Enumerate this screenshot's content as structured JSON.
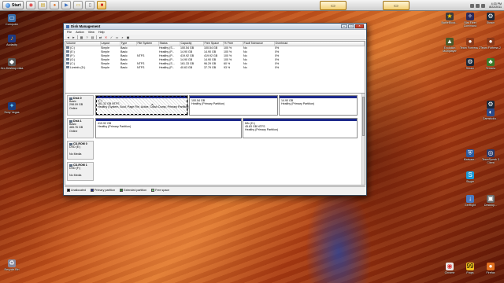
{
  "taskbar": {
    "start_label": "Start",
    "clock_time": "4:33 PM",
    "clock_date": "8/22/2011"
  },
  "desktop_left": [
    {
      "label": "Computer"
    },
    {
      "label": "Audacity"
    },
    {
      "label": "Zen Desktop vista"
    },
    {
      "label": "Sony Vegas"
    },
    {
      "label": "Recycle Bin"
    }
  ],
  "desktop_right": [
    {
      "label": "BattleBlock..."
    },
    {
      "label": "Star Fleet Command"
    },
    {
      "label": "Steam"
    },
    {
      "label": "Evolution Multiplayer"
    },
    {
      "label": "Team Fortress 2"
    },
    {
      "label": "Team Fortress 2"
    },
    {
      "label": "Steam"
    },
    {
      "label": "Terraria"
    },
    {
      "label": "Steam"
    },
    {
      "label": "Camstudio..."
    },
    {
      "label": "Malware..."
    },
    {
      "label": "TeamSpeak 3 Client"
    },
    {
      "label": "Skype"
    },
    {
      "label": "GetRight"
    },
    {
      "label": "Desktop..."
    },
    {
      "label": "Chrome"
    },
    {
      "label": "Fraps"
    },
    {
      "label": "Firefox"
    }
  ],
  "window": {
    "title": "Disk Management",
    "menu": [
      "File",
      "Action",
      "View",
      "Help"
    ],
    "columns": [
      "Volume",
      "Layout",
      "Type",
      "File System",
      "Status",
      "Capacity",
      "Free Space",
      "% Free",
      "Fault Tolerance",
      "Overhead"
    ],
    "rows": [
      [
        "(C:)",
        "Simple",
        "Basic",
        "",
        "Healthy (S...",
        "100.54 GB",
        "100.54 GB",
        "100 %",
        "No",
        "0%"
      ],
      [
        "(E:)",
        "Simple",
        "Basic",
        "",
        "Healthy (P...",
        "14.90 GB",
        "14.90 GB",
        "100 %",
        "No",
        "0%"
      ],
      [
        "(F:)",
        "Simple",
        "Basic",
        "NTFS",
        "Healthy (P...",
        "419.92 GB",
        "419.92 GB",
        "100 %",
        "No",
        "0%"
      ],
      [
        "(G:)",
        "Simple",
        "Basic",
        "",
        "Healthy (P...",
        "14.90 GB",
        "14.90 GB",
        "100 %",
        "No",
        "0%"
      ],
      [
        "(C:)",
        "Simple",
        "Basic",
        "NTFS",
        "Healthy (S...",
        "161.33 GB",
        "96.29 GB",
        "60 %",
        "No",
        "0%"
      ],
      [
        "Liveinfo (D:)",
        "Simple",
        "Basic",
        "NTFS",
        "Healthy (P...",
        "40.63 GB",
        "37.79 GB",
        "93 %",
        "No",
        "0%"
      ]
    ],
    "disks": [
      {
        "name": "Disk 0",
        "type": "Basic",
        "size": "298.09 GB",
        "state": "Online",
        "partitions": [
          {
            "name": "(C:)",
            "line1": "161.33 GB NTFS",
            "line2": "Healthy (System, Boot, Page File, Active, Crash Dump, Primary Partition)"
          },
          {
            "name": "",
            "line1": "100.54 GB",
            "line2": "Healthy (Primary Partition)"
          },
          {
            "name": "",
            "line1": "14.90 GB",
            "line2": "Healthy (Primary Partition)"
          }
        ]
      },
      {
        "name": "Disk 1",
        "type": "Basic",
        "size": "465.76 GB",
        "state": "Online",
        "partitions": [
          {
            "name": "",
            "line1": "419.92 GB",
            "line2": "Healthy (Primary Partition)"
          },
          {
            "name": "Mfx (D:)",
            "line1": "45.83 GB NTFS",
            "line2": "Healthy (Primary Partition)"
          }
        ]
      },
      {
        "name": "CD-ROM 0",
        "type": "DVD (E:)",
        "size": "",
        "state": "No Media",
        "partitions": []
      },
      {
        "name": "CD-ROM 1",
        "type": "DVD (F:)",
        "size": "",
        "state": "No Media",
        "partitions": []
      }
    ],
    "legend": [
      {
        "label": "Unallocated",
        "color": "#000000"
      },
      {
        "label": "Primary partition",
        "color": "#1e2a8c"
      },
      {
        "label": "Extended partition",
        "color": "#2e8b2e"
      },
      {
        "label": "Free space",
        "color": "#7fd07f"
      }
    ]
  }
}
